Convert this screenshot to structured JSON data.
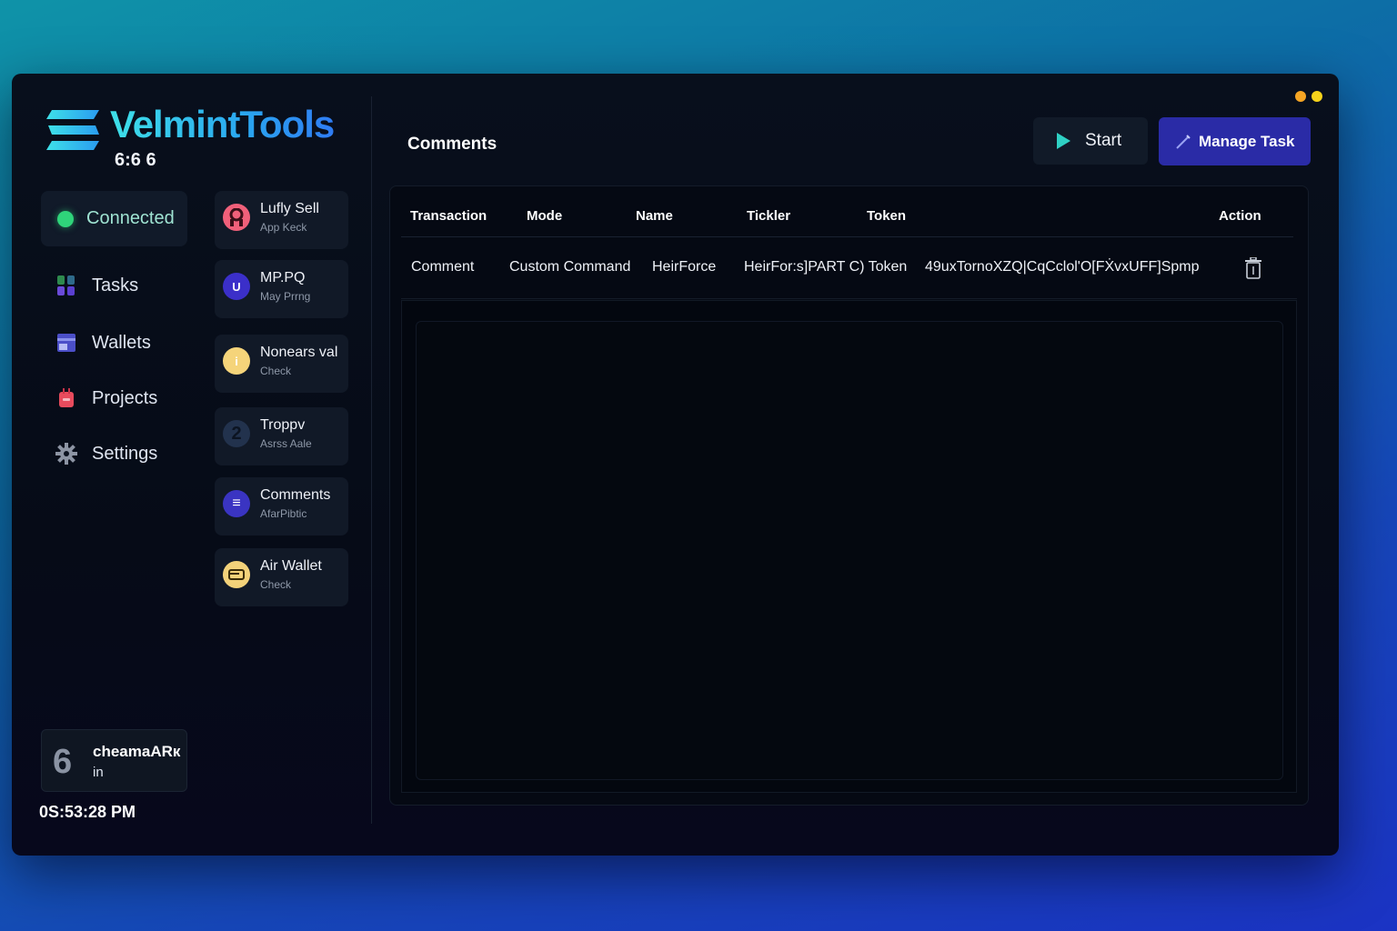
{
  "app": {
    "brand_name": "VelmintTools",
    "brand_sub": "6:6 6"
  },
  "sidebar": {
    "status_label": "Connected",
    "items": [
      {
        "label": "Tasks",
        "icon": "tasks-icon"
      },
      {
        "label": "Wallets",
        "icon": "wallet-icon"
      },
      {
        "label": "Projects",
        "icon": "projects-icon"
      },
      {
        "label": "Settings",
        "icon": "gear-icon"
      }
    ],
    "user": {
      "avatar": "6",
      "name": "cheamaARк",
      "status": "in"
    },
    "clock": "0S:53:28 PM"
  },
  "task_list": [
    {
      "title": "Lufly Sell",
      "sub": "App Keck",
      "icon_glyph": "",
      "color": "#f0607a"
    },
    {
      "title": "MP.PQ",
      "sub": "May Prrng",
      "icon_glyph": "U",
      "color": "#3b2fc9"
    },
    {
      "title": "Nonears val",
      "sub": "Check",
      "icon_glyph": "i",
      "color": "#f5d47a"
    },
    {
      "title": "Troppv",
      "sub": "Asrss Aale",
      "icon_glyph": "2",
      "color": "#22324d"
    },
    {
      "title": "Comments",
      "sub": "AfarPibtic",
      "icon_glyph": "≡",
      "color": "#3a34c2"
    },
    {
      "title": "Air  Wallet",
      "sub": "Check",
      "icon_glyph": "",
      "color": "#f3d27a"
    }
  ],
  "main": {
    "title": "Comments",
    "start_label": "Start",
    "manage_label": "Manage Task",
    "table": {
      "headers": [
        "Transaction",
        "Mode",
        "Name",
        "Tickler",
        "Token",
        "Action"
      ],
      "rows": [
        [
          "Comment",
          "Custom Command",
          "HeirForce",
          "HeirFor:s]PART C) Token",
          "49uxTornoXZQ|CqCclol'O[FẊvxUFF]Spmp"
        ]
      ]
    }
  },
  "colors": {
    "accent": "#2a2ba6",
    "connected": "#2fd47a",
    "play": "#2fd0c4"
  }
}
